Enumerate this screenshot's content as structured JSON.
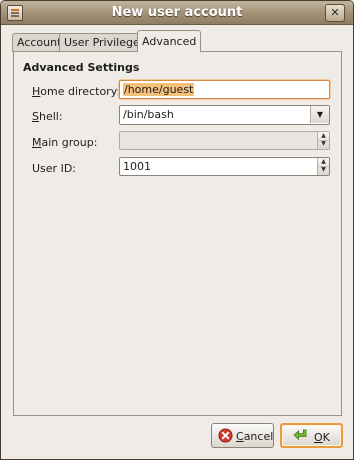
{
  "window": {
    "title": "New user account"
  },
  "tabs": [
    {
      "label": "Account",
      "mnemonic": "",
      "active": false
    },
    {
      "label": "User Privileges",
      "mnemonic": "",
      "active": false
    },
    {
      "label": "Advanced",
      "mnemonic": "",
      "active": true
    }
  ],
  "advanced": {
    "section_title": "Advanced Settings",
    "home_directory": {
      "label_mn": "H",
      "label_rest": "ome directory:",
      "value": "/home/guest"
    },
    "shell": {
      "label_mn": "S",
      "label_rest": "hell:",
      "value": "/bin/bash"
    },
    "main_group": {
      "label_mn": "M",
      "label_rest": "ain group:",
      "value": ""
    },
    "user_id": {
      "label_mn": "",
      "label_rest": "User ID:",
      "value": "1001"
    }
  },
  "buttons": {
    "cancel": {
      "mn": "C",
      "rest": "ancel"
    },
    "ok": {
      "mn": "O",
      "rest": "K"
    }
  },
  "colors": {
    "titlebar": "#a49379",
    "focus": "#d48a4a",
    "selection": "#f5c07a",
    "default_button": "#e99a3a"
  },
  "icons": {
    "window_menu": "window-menu-icon",
    "close": "close-icon",
    "cancel": "cancel-icon",
    "ok": "ok-arrow-icon"
  }
}
